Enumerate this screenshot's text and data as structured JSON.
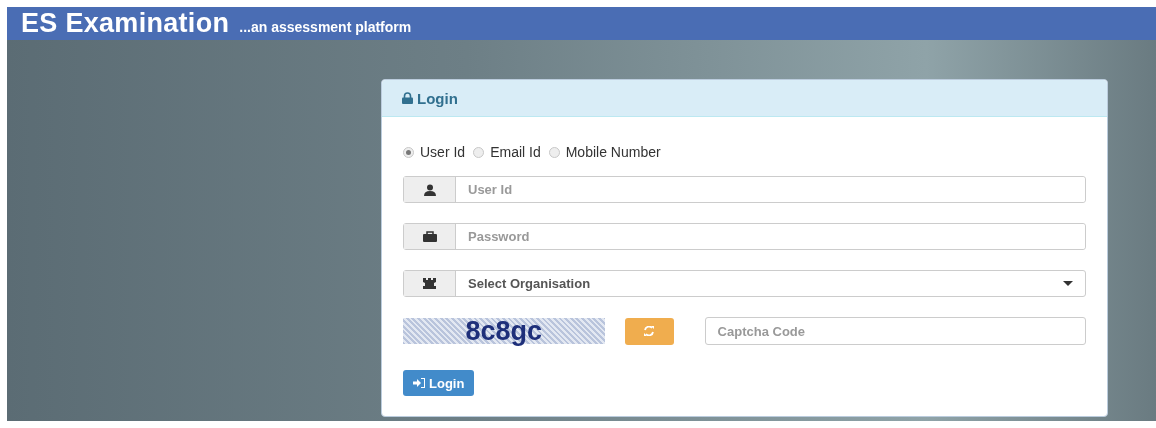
{
  "header": {
    "title": "ES Examination",
    "tagline": "...an assessment platform"
  },
  "login_panel": {
    "title": "Login",
    "login_type": [
      {
        "label": "User Id",
        "selected": true
      },
      {
        "label": "Email Id",
        "selected": false
      },
      {
        "label": "Mobile Number",
        "selected": false
      }
    ],
    "fields": [
      {
        "kind": "text",
        "placeholder": "User Id"
      },
      {
        "kind": "password",
        "placeholder": "Password"
      },
      {
        "kind": "select",
        "value": "Select Organisation"
      }
    ],
    "captcha": {
      "code": "8c8gc",
      "placeholder": "Captcha Code"
    },
    "submit": "Login"
  }
}
